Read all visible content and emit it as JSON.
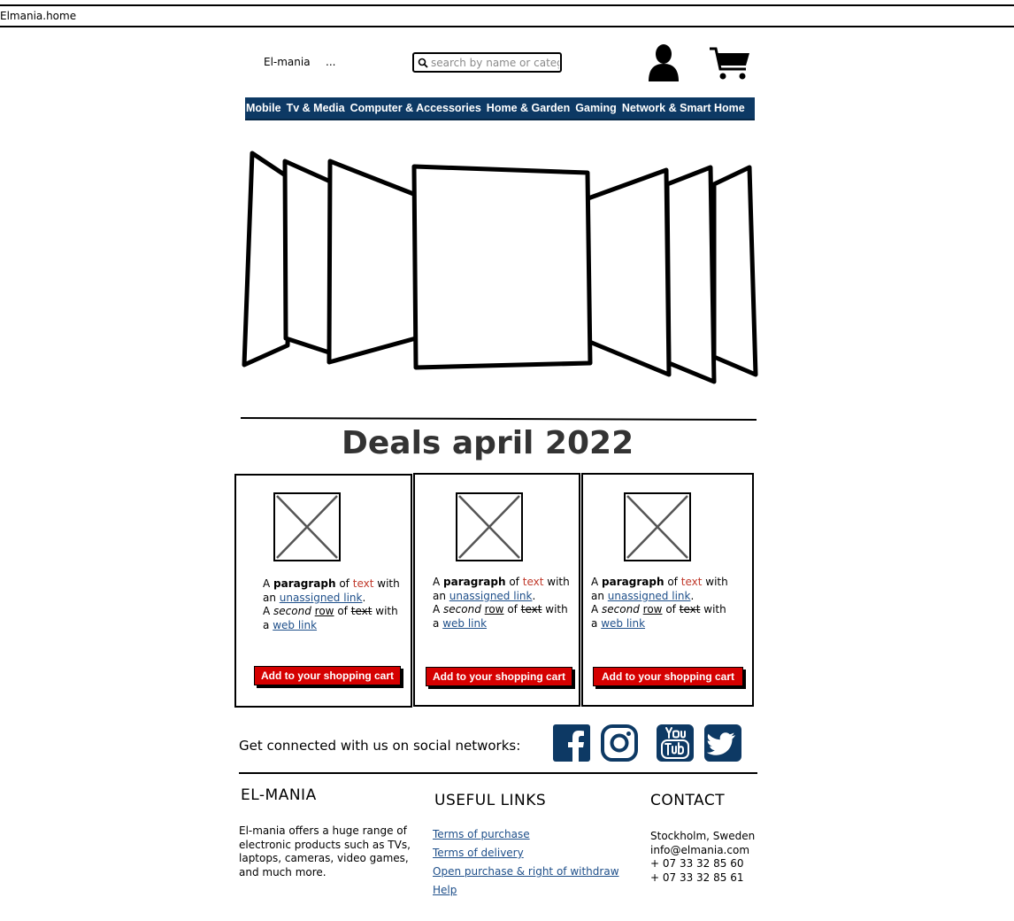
{
  "window": {
    "title": "Elmania.home"
  },
  "header": {
    "brand": "El-mania",
    "dots": "...",
    "search_placeholder": "search by name or category"
  },
  "nav": {
    "items": [
      "Mobile",
      "Tv & Media",
      "Computer & Accessories",
      "Home & Garden",
      "Gaming",
      "Network & Smart Home"
    ]
  },
  "deals": {
    "title": "Deals april 2022",
    "cards": [
      {
        "a": "A",
        "paragraph": "paragraph",
        "of": "of",
        "text": "text",
        "with": "with",
        "an": "an",
        "unassigned_link": "unassigned link",
        "period": ".",
        "a2": "A",
        "second": "second",
        "row": "row",
        "of2": "of",
        "text2": "text",
        "with2": "with",
        "a3": "a",
        "web_link": "web link",
        "button": "Add to your shopping cart"
      },
      {
        "a": "A",
        "paragraph": "paragraph",
        "of": "of",
        "text": "text",
        "with": "with",
        "an": "an",
        "unassigned_link": "unassigned link",
        "period": ".",
        "a2": "A",
        "second": "second",
        "row": "row",
        "of2": "of",
        "text2": "text",
        "with2": "with",
        "a3": "a",
        "web_link": "web link",
        "button": "Add to your shopping cart"
      },
      {
        "a": "A",
        "paragraph": "paragraph",
        "of": "of",
        "text": "text",
        "with": "with",
        "an": "an",
        "unassigned_link": "unassigned link",
        "period": ".",
        "a2": "A",
        "second": "second",
        "row": "row",
        "of2": "of",
        "text2": "text",
        "with2": "with",
        "a3": "a",
        "web_link": "web link",
        "button": "Add to your shopping cart"
      }
    ]
  },
  "social": {
    "text": "Get connected with us on social networks:",
    "icons": [
      "facebook-icon",
      "instagram-icon",
      "youtube-icon",
      "twitter-icon"
    ],
    "color": "#0d3964"
  },
  "footer": {
    "about_heading": "EL-MANIA",
    "about_lines": [
      "El-mania offers a huge range of",
      "electronic products such as TVs,",
      "laptops, cameras, video games,",
      "and much more."
    ],
    "links_heading": "USEFUL LINKS",
    "links": [
      "Terms of purchase",
      "Terms of delivery",
      "Open purchase & right of withdraw",
      "Help"
    ],
    "contact_heading": "CONTACT",
    "contact": [
      "Stockholm, Sweden",
      "info@elmania.com",
      "+ 07 33 32 85 60",
      "+ 07 33 32 85 61"
    ]
  },
  "colors": {
    "nav_bg": "#0d3964",
    "button_bg": "#d50000",
    "link": "#1e4f8a",
    "accent_text": "#c0392b"
  }
}
